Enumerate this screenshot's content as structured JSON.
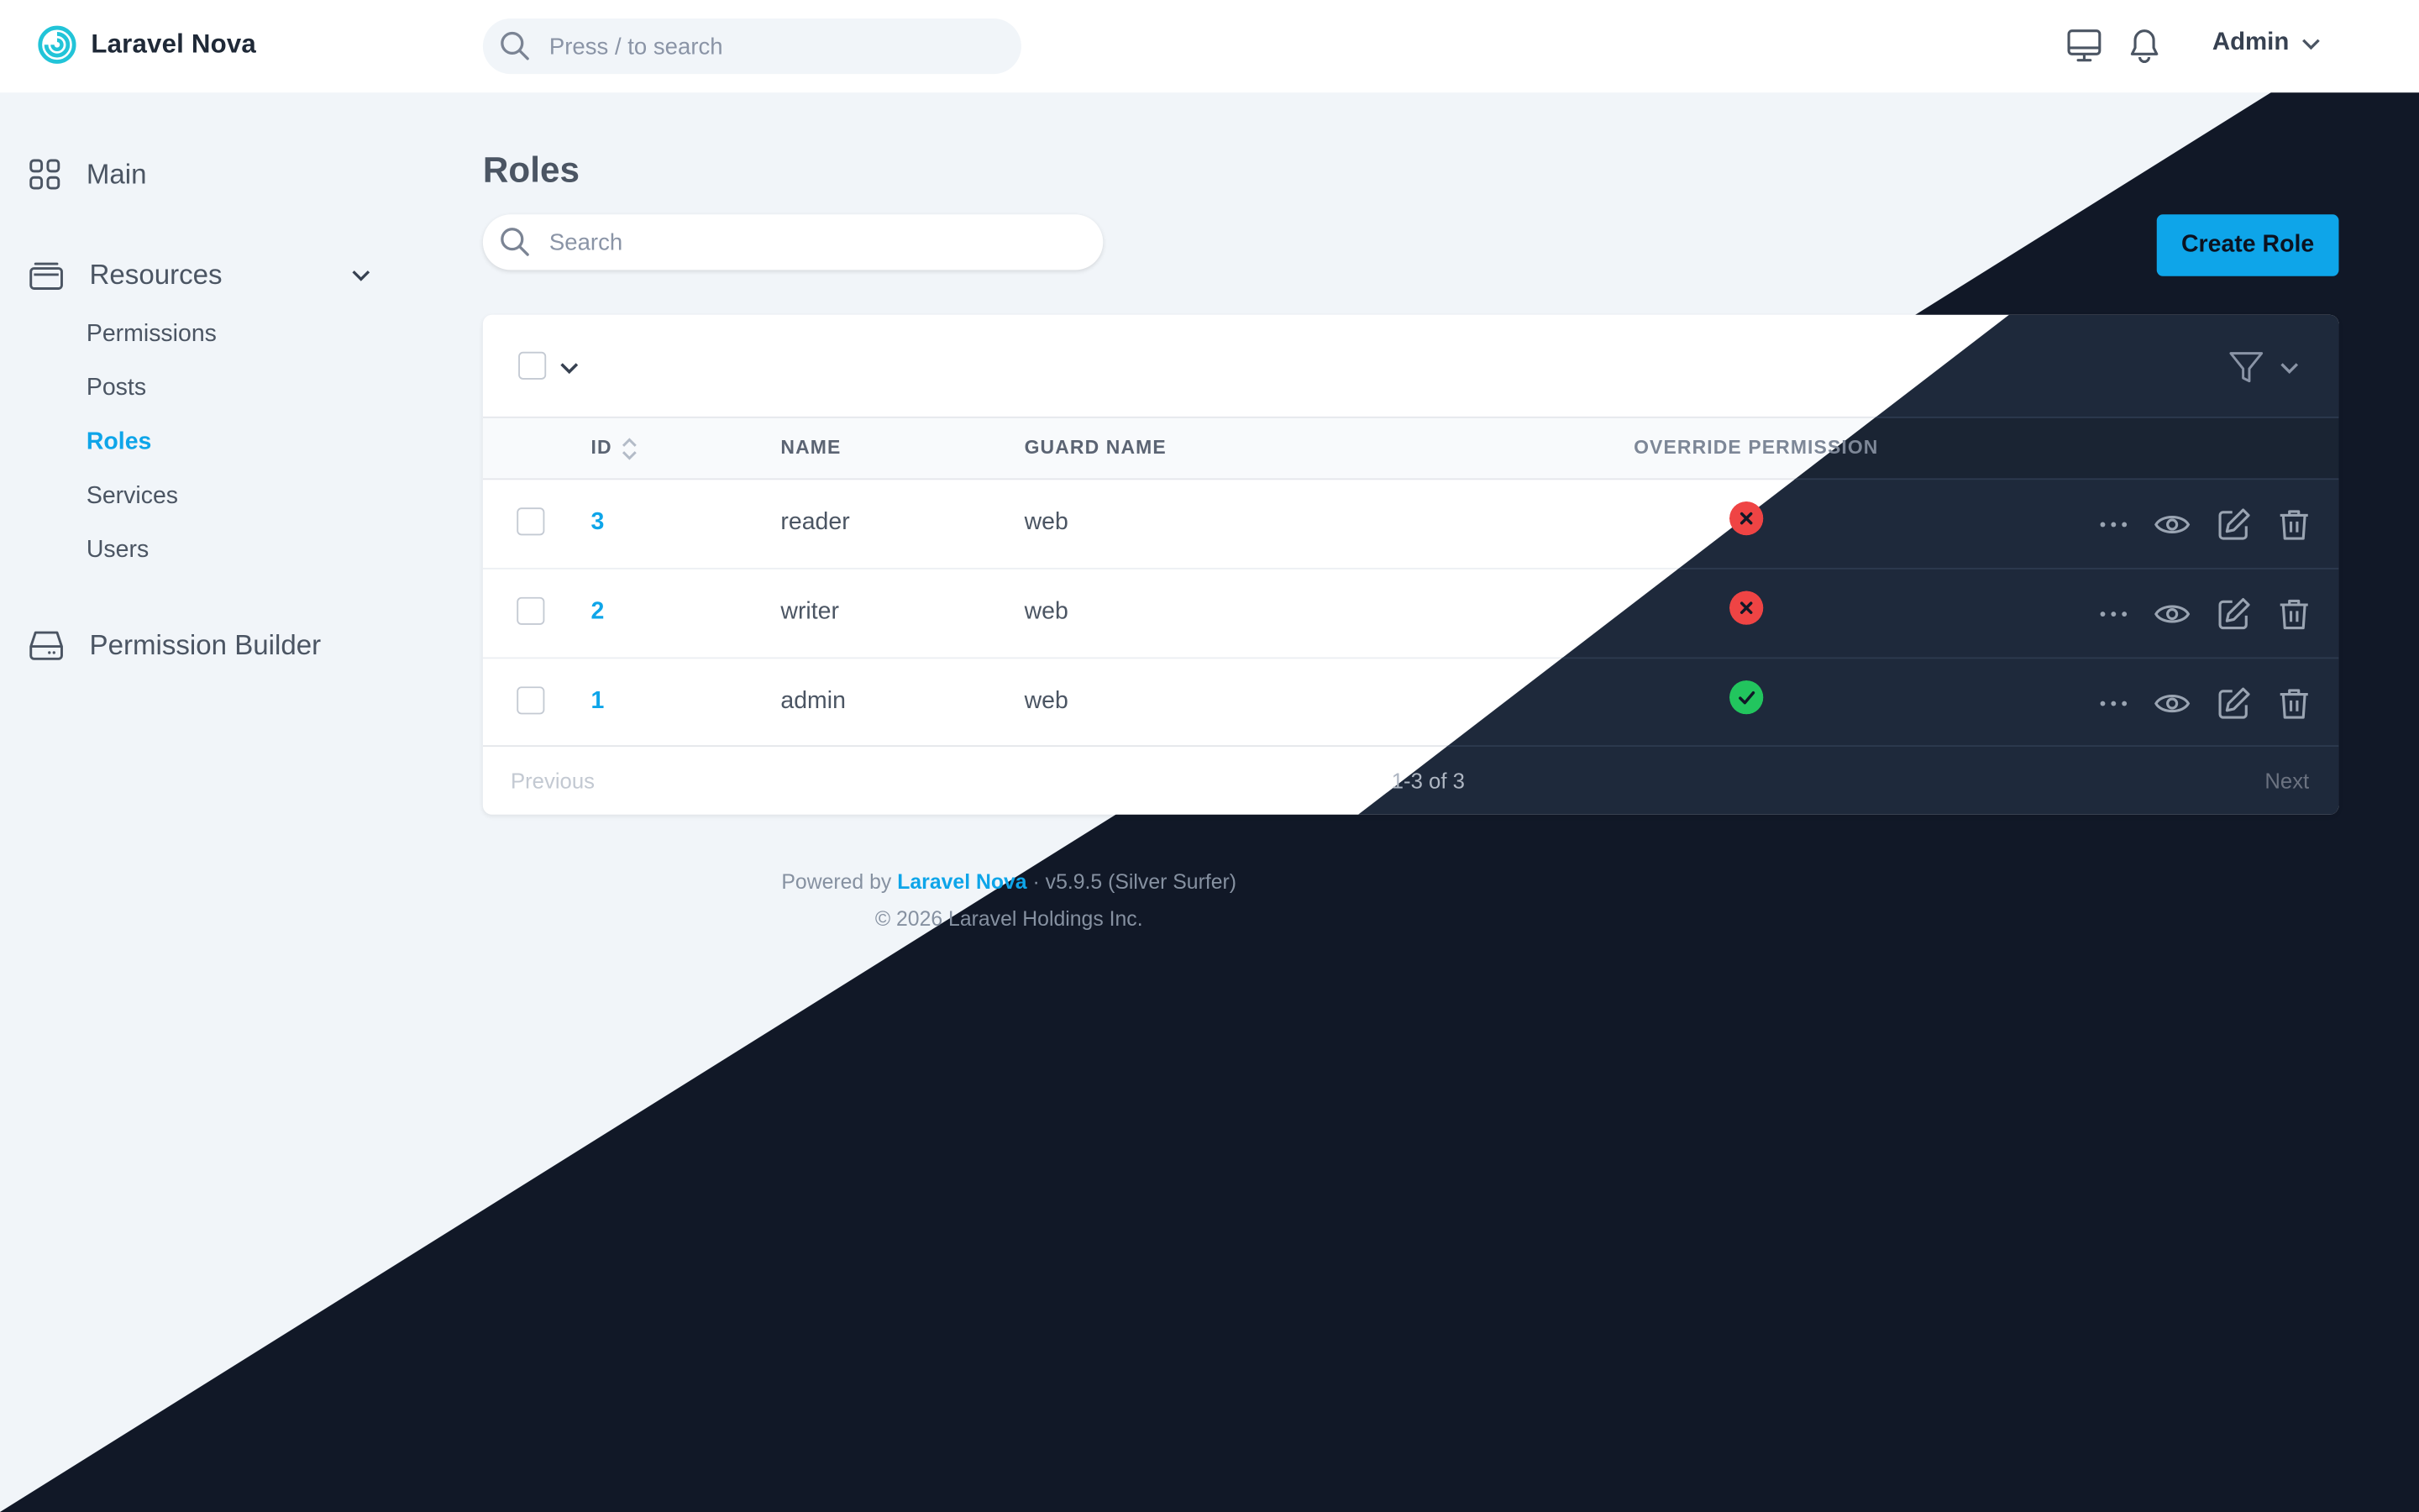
{
  "app": {
    "name": "Laravel Nova"
  },
  "header": {
    "search_placeholder": "Press / to search",
    "user_name": "Admin"
  },
  "sidebar": {
    "main_label": "Main",
    "resources_label": "Resources",
    "resources_items": [
      "Permissions",
      "Posts",
      "Roles",
      "Services",
      "Users"
    ],
    "active_item": "Roles",
    "permission_builder_label": "Permission Builder"
  },
  "page": {
    "title": "Roles",
    "search_placeholder": "Search",
    "create_button": "Create Role"
  },
  "table": {
    "columns": [
      "ID",
      "NAME",
      "GUARD NAME",
      "OVERRIDE PERMISSION"
    ],
    "rows": [
      {
        "id": "3",
        "name": "reader",
        "guard": "web",
        "override": false
      },
      {
        "id": "2",
        "name": "writer",
        "guard": "web",
        "override": false
      },
      {
        "id": "1",
        "name": "admin",
        "guard": "web",
        "override": true
      }
    ],
    "pagination": {
      "previous": "Previous",
      "count": "1-3 of 3",
      "next": "Next"
    }
  },
  "footer": {
    "powered_prefix": "Powered by",
    "powered_link": "Laravel Nova",
    "version": "· v5.9.5 (Silver Surfer)",
    "copyright": "© 2026 Laravel Holdings Inc."
  },
  "colors": {
    "accent": "#0ea5e9",
    "danger": "#ef4444",
    "success": "#22c55e",
    "dark_bg": "#111827",
    "light_bg": "#f1f5f9"
  }
}
